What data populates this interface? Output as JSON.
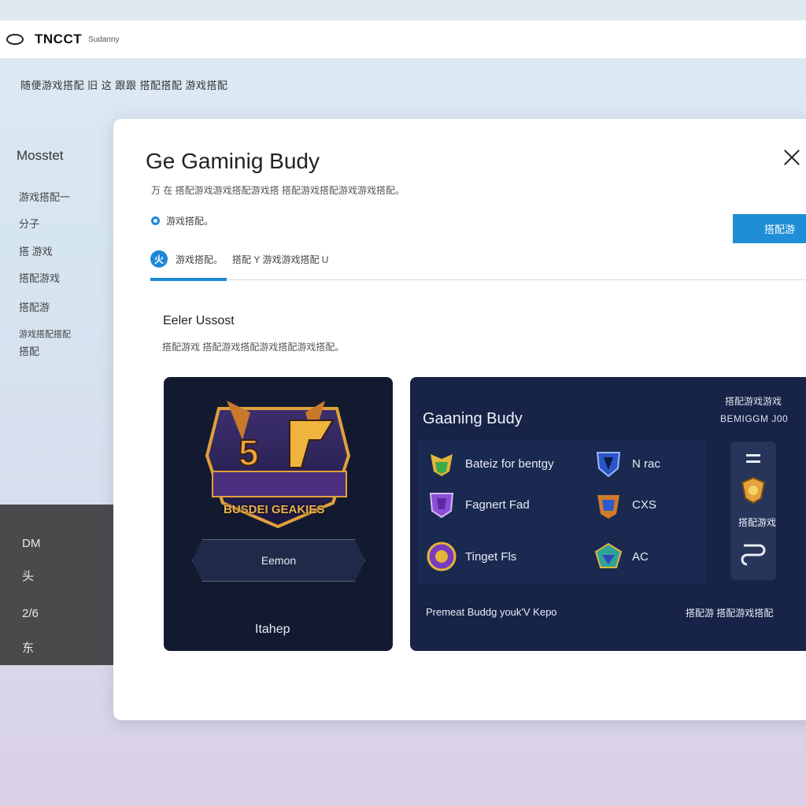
{
  "topbar": {
    "brand": "TNCCT",
    "brand_sub": "Sudanny"
  },
  "subtitle": "随便游戏搭配 旧 这 跟跟 搭配搭配 游戏搭配",
  "sidebar": {
    "title": "Mosstet",
    "items": [
      "游戏搭配一",
      "分子",
      "搭 游戏",
      "搭配游戏",
      "搭配游",
      "游戏搭配搭配",
      "搭配"
    ]
  },
  "dark_panel": {
    "items": [
      "DM",
      "头",
      "2/6",
      "东"
    ]
  },
  "dialog": {
    "title": "Ge Gaminig Budy",
    "description": "万 在 搭配游戏游戏搭配游戏搭 搭配游戏搭配游戏游戏搭配。",
    "radio_label": "游戏搭配。",
    "primary_button": "搭配游",
    "tab_icon": "火",
    "tab_label": "游戏搭配。",
    "tab_label2": "搭配 Y 游戏游戏搭配 U",
    "section_title": "Eeler Ussost",
    "section_desc": "搭配游戏 搭配游戏搭配游戏搭配游戏搭配。"
  },
  "left_card": {
    "badge_number": "5",
    "badge_text": "BUSDEI GEAKIES",
    "button": "Eemon",
    "footer": "Itahep"
  },
  "right_card": {
    "title": "Gaaning Budy",
    "top_right_line1": "搭配游戏游戏",
    "top_right_line2": "BEMIGGM J00",
    "items": [
      {
        "label": "Bateiz for bentgy",
        "icon": "green-helmet-icon"
      },
      {
        "label": "N rac",
        "icon": "blue-shield-icon"
      },
      {
        "label": "Fagnert Fad",
        "icon": "purple-shield-icon"
      },
      {
        "label": "CXS",
        "icon": "warrior-mask-icon"
      },
      {
        "label": "Tinget Fls",
        "icon": "gold-purple-emblem-icon"
      },
      {
        "label": "AC",
        "icon": "teal-emblem-icon"
      }
    ],
    "side_tile_label": "搭配游戏",
    "footer_left": "Premeat Buddg youk'V Kepo",
    "footer_right": "搭配游 搭配游戏搭配"
  }
}
